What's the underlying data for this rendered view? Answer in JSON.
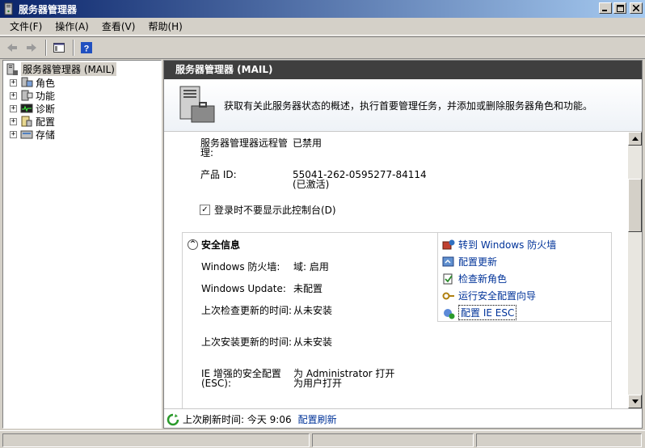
{
  "window": {
    "title": "服务器管理器"
  },
  "menu": [
    {
      "label": "文件(F)"
    },
    {
      "label": "操作(A)"
    },
    {
      "label": "查看(V)"
    },
    {
      "label": "帮助(H)"
    }
  ],
  "tree": {
    "root": "服务器管理器 (MAIL)",
    "nodes": [
      {
        "label": "角色",
        "icon": "roles-icon"
      },
      {
        "label": "功能",
        "icon": "features-icon"
      },
      {
        "label": "诊断",
        "icon": "diagnostics-icon"
      },
      {
        "label": "配置",
        "icon": "configuration-icon"
      },
      {
        "label": "存储",
        "icon": "storage-icon"
      }
    ]
  },
  "pane": {
    "header": "服务器管理器 (MAIL)",
    "description": "获取有关此服务器状态的概述，执行首要管理任务，并添加或删除服务器角色和功能。"
  },
  "info": {
    "remote_mgmt_label": "服务器管理器远程管理:",
    "remote_mgmt_value": "已禁用",
    "product_id_label": "产品 ID:",
    "product_id_value": "55041-262-0595277-84114 (已激活)",
    "checkbox_label": "登录时不要显示此控制台(D)"
  },
  "security": {
    "title": "安全信息",
    "rows": [
      {
        "label": "Windows 防火墙:",
        "value": "域: 启用"
      },
      {
        "label": "Windows Update:",
        "value": "未配置"
      },
      {
        "label": "上次检查更新的时间:",
        "value": "从未安装"
      },
      {
        "label": "上次安装更新的时间:",
        "value": "从未安装"
      },
      {
        "label": "IE 增强的安全配置(ESC):",
        "value": "为 Administrator 打开\n为用户打开"
      }
    ],
    "tasks": [
      {
        "label": "转到 Windows 防火墙",
        "icon": "firewall-icon"
      },
      {
        "label": "配置更新",
        "icon": "update-icon"
      },
      {
        "label": "检查新角色",
        "icon": "check-roles-icon"
      },
      {
        "label": "运行安全配置向导",
        "icon": "wizard-icon"
      },
      {
        "label": "配置 IE ESC",
        "icon": "ie-esc-icon"
      }
    ]
  },
  "status": {
    "last_refresh": "上次刷新时间: 今天 9:06",
    "refresh_link": "配置刷新"
  }
}
